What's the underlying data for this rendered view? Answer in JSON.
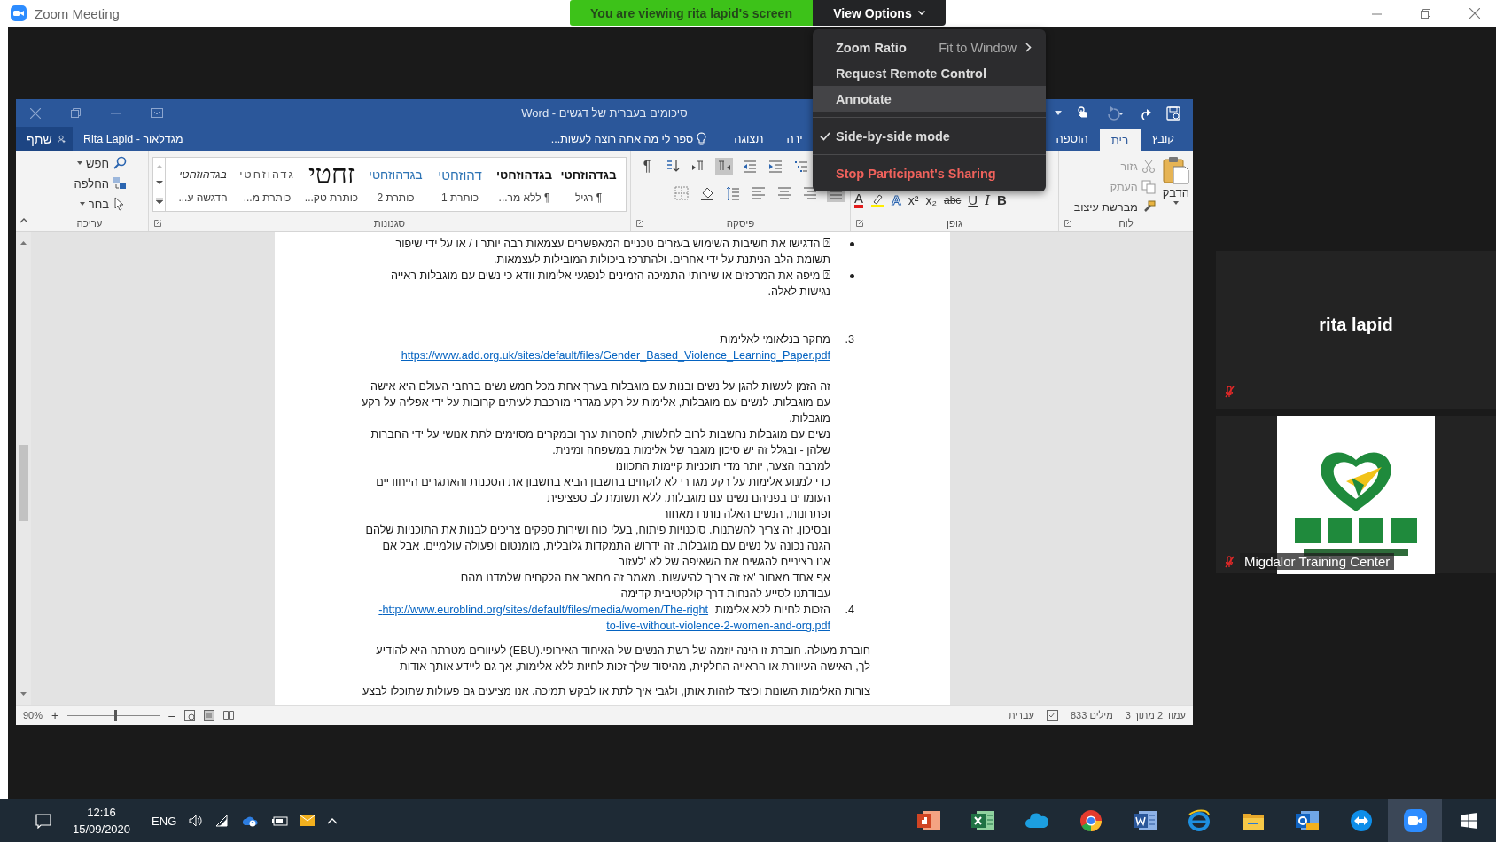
{
  "window": {
    "title": "Zoom Meeting"
  },
  "share_banner": {
    "text": "You are viewing rita lapid's screen",
    "view_options": "View Options"
  },
  "view_menu": {
    "items": [
      {
        "kind": "submenu",
        "label": "Zoom Ratio",
        "value": "Fit to Window",
        "highlighted": false,
        "separator_before": false
      },
      {
        "kind": "item",
        "label": "Request Remote Control",
        "highlighted": false,
        "separator_before": false
      },
      {
        "kind": "item",
        "label": "Annotate",
        "highlighted": true,
        "separator_before": false
      },
      {
        "kind": "check",
        "label": "Side-by-side mode",
        "checked": true,
        "highlighted": false,
        "separator_before": true
      },
      {
        "kind": "danger",
        "label": "Stop Participant's Sharing",
        "highlighted": false,
        "separator_before": true
      }
    ]
  },
  "word": {
    "title": "סיכומים בעברית של דגשים - Word",
    "account": "מגדלאור - Rita Lapid",
    "share": "שתף",
    "tell_me": "ספר לי מה אתה רוצה לעשות...",
    "tabs": [
      {
        "label": "קובץ",
        "selected": false
      },
      {
        "label": "בית",
        "selected": true
      },
      {
        "label": "הוספה",
        "selected": false
      },
      {
        "label": "ירה",
        "selected": false
      },
      {
        "label": "תצוגה",
        "selected": false
      }
    ],
    "ribbon": {
      "clipboard": {
        "label": "לוח",
        "paste": "הדבק",
        "items": [
          {
            "kind": "cut",
            "label": "גזור",
            "disabled": true
          },
          {
            "kind": "copy",
            "label": "העתק",
            "disabled": true
          },
          {
            "kind": "painter",
            "label": "מברשת עיצוב",
            "disabled": false
          }
        ]
      },
      "font": {
        "label": "גופן",
        "buttons": [
          {
            "kind": "bold",
            "label": "B"
          },
          {
            "kind": "italic",
            "label": "I"
          },
          {
            "kind": "underline",
            "label": "U"
          },
          {
            "kind": "strike",
            "label": "abc"
          },
          {
            "kind": "sub",
            "label": "x₂"
          },
          {
            "kind": "sup",
            "label": "x²"
          },
          {
            "kind": "effects",
            "label": "A"
          },
          {
            "kind": "highlight"
          },
          {
            "kind": "color",
            "label": "A"
          }
        ]
      },
      "paragraph": {
        "label": "פיסקה",
        "top_row": [
          {
            "kind": "marks",
            "label": "¶",
            "on": false
          },
          {
            "kind": "sort",
            "on": false
          },
          {
            "kind": "ltr",
            "on": false
          },
          {
            "kind": "rtl",
            "on": true
          },
          {
            "kind": "outdent",
            "on": false
          },
          {
            "kind": "indent",
            "on": false
          },
          {
            "kind": "multilevel",
            "on": false
          }
        ],
        "bottom_row": [
          {
            "kind": "borders",
            "on": false
          },
          {
            "kind": "shading",
            "on": false
          },
          {
            "kind": "spacing",
            "on": false
          },
          {
            "kind": "left",
            "on": false
          },
          {
            "kind": "center",
            "on": false
          },
          {
            "kind": "right",
            "on": false
          },
          {
            "kind": "justify",
            "on": true
          }
        ]
      },
      "styles": {
        "label": "סגנונות",
        "items": [
          {
            "kind": "normal",
            "preview": "בגדהוזחטי",
            "name": "¶ רגיל"
          },
          {
            "kind": "normal",
            "preview": "בגדהוזחטי",
            "name": "¶ ללא מר..."
          },
          {
            "kind": "heading1",
            "preview": "דהוזחטי",
            "name": "כותרת 1"
          },
          {
            "kind": "heading2",
            "preview": "בגדהוזחטי",
            "name": "כותרת 2"
          },
          {
            "kind": "title",
            "preview": "זחטי",
            "name": "כותרת טק..."
          },
          {
            "kind": "subtitle",
            "preview": "גדהוזחטי",
            "name": "כותרת מ..."
          },
          {
            "kind": "emphasis",
            "preview": "בגדהוזחטי",
            "name": "הדגשה ע..."
          }
        ]
      },
      "editing": {
        "label": "עריכה",
        "items": [
          {
            "kind": "find",
            "label": "חפש"
          },
          {
            "kind": "replace",
            "label": "החלפה"
          },
          {
            "kind": "select",
            "label": "בחר"
          }
        ]
      }
    },
    "document": {
      "blocks": [
        {
          "kind": "bullet",
          "lines": [
            "⍰ הדגישו את חשיבות השימוש בעזרים טכניים המאפשרים עצמאות רבה יותר ו / או על ידי שיפור",
            "תשומת הלב הניתנת על ידי אחרים. ולהתרכז ביכולות המובילות לעצמאות."
          ]
        },
        {
          "kind": "bullet",
          "lines": [
            "⍰ מיפה את המרכזים או שירותי התמיכה הזמינים לנפגעי אלימות וודא כי נשים עם מוגבלות ראייה",
            "נגישות לאלה."
          ]
        },
        {
          "kind": "numbered",
          "number": "3.",
          "text": "מחקר בנלאומי לאלימות",
          "links": [
            "https://www.add.org.uk/sites/default/files/Gender_Based_Violence_Learning_Paper.pdf"
          ]
        },
        {
          "kind": "para",
          "lines": [
            "זה הזמן לעשות להגן על נשים ובנות עם מוגבלות בערך אחת מכל חמש נשים ברחבי העולם היא אישה",
            "עם מוגבלות. לנשים עם מוגבלות, אלימות על רקע מגדרי מורכבת לעיתים קרובות על ידי אפליה על רקע",
            "מוגבלות.",
            "נשים עם מוגבלות נחשבות לרוב לחלשות, לחסרות ערך ובמקרים מסוימים לתת אנושי על ידי החברות",
            "שלהן - ובגלל זה יש סיכון מוגבר של אלימות במשפחה ומינית.",
            "למרבה הצער, יותר מדי תוכניות קיימות התכוונו",
            "כדי למנוע אלימות על רקע מגדרי לא לוקחים בחשבון הביא בחשבון את הסכנות והאתגרים הייחודיים",
            "העומדים בפניהם נשים עם מוגבלות. ללא תשומת לב ספציפית",
            "ופתרונות, הנשים האלה נותרו מאחור",
            "ובסיכון. זה צריך להשתנות. סוכנויות פיתוח, בעלי כוח ושירות ספקים צריכים לבנות את התוכניות שלהם",
            "הגנה נכונה על נשים עם מוגבלות. זה ידרוש התמקדות גלובלית, מומנטום ופעולה עולמיים. אבל אם",
            "אנו רציניים להגשים את השאיפה  של לא 'לעזוב",
            "אף אחד מאחור 'אז זה צריך להיעשות. מאמר זה מתאר את הלקחים שלמדנו מהם",
            "עבודתנו לסייע להנחות דרך קולקטיבית קדימה"
          ]
        },
        {
          "kind": "numbered",
          "number": "4.",
          "text": "הזכות לחיות ללא אלימות",
          "inline_link": "http://www.euroblind.org/sites/default/files/media/women/The-right-",
          "links": [
            "to-live-without-violence-2-women-and-org.pdf"
          ]
        },
        {
          "kind": "body",
          "lines": [
            "חוברת מעולה. חוברת זו הינה יוזמה של רשת הנשים של האיחוד האירופי.(EBU) לעיוורים מטרתה היא להודיע",
            "לך, האישה העיוורת או הראייה החלקית, מהיסוד שלך זכות לחיות ללא אלימות, אך גם ליידע אותך אודות"
          ]
        },
        {
          "kind": "body",
          "lines": [
            "צורות האלימות השונות וכיצד לזהות אותן, ולגבי איך לתת או לבקש תמיכה. אנו מציעים גם פעולות שתוכלו לבצע"
          ]
        }
      ]
    },
    "status_bar": {
      "page": "עמוד 2 מתוך 3",
      "words": "833 מילים",
      "language": "עברית",
      "zoom": "90%",
      "zoom_in": "+",
      "zoom_out": "–",
      "level": 0.52
    }
  },
  "participants": [
    {
      "kind": "name",
      "name": "rita lapid",
      "muted": true
    },
    {
      "kind": "picture",
      "name": "Migdalor Training Center",
      "muted": true
    }
  ],
  "taskbar": {
    "time": "12:16",
    "date": "15/09/2020",
    "language": "ENG",
    "apps": [
      {
        "kind": "presentation",
        "active": false
      },
      {
        "kind": "spreadsheet",
        "active": false
      },
      {
        "kind": "cloud",
        "active": false
      },
      {
        "kind": "browser",
        "active": false
      },
      {
        "kind": "document",
        "active": false
      },
      {
        "kind": "globe",
        "active": false
      },
      {
        "kind": "folder",
        "active": false
      },
      {
        "kind": "mail",
        "active": false
      },
      {
        "kind": "remote",
        "active": false
      },
      {
        "kind": "video",
        "active": true
      }
    ]
  }
}
